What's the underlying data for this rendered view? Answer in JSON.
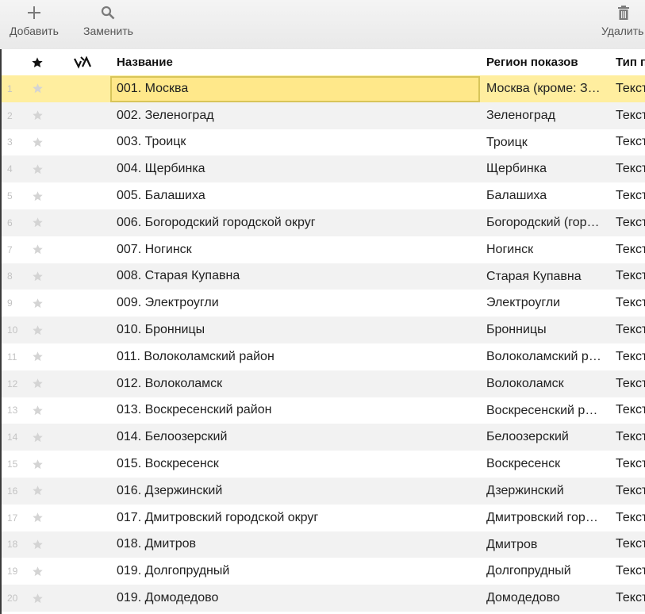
{
  "toolbar": {
    "add_label": "Добавить",
    "replace_label": "Заменить",
    "delete_label": "Удалить"
  },
  "header": {
    "name_label": "Название",
    "region_label": "Регион показов",
    "type_label": "Тип п"
  },
  "colors": {
    "selected_row": "#ffee9f",
    "selected_cell_border": "#d8c55a",
    "alt_row": "#f2f2f2",
    "star_inactive": "#d4d4d4"
  },
  "icons": {
    "add": "plus-icon",
    "replace": "search-icon",
    "delete": "trash-icon",
    "favorite_header": "star-icon",
    "mark_header": "mark-icon"
  },
  "rows": [
    {
      "num": "1",
      "name": "001. Москва",
      "region": "Москва (кроме: Зеленоград)",
      "type": "Текст"
    },
    {
      "num": "2",
      "name": "002. Зеленоград",
      "region": "Зеленоград",
      "type": "Текст"
    },
    {
      "num": "3",
      "name": "003. Троицк",
      "region": "Троицк",
      "type": "Текст"
    },
    {
      "num": "4",
      "name": "004. Щербинка",
      "region": "Щербинка",
      "type": "Текст"
    },
    {
      "num": "5",
      "name": "005. Балашиха",
      "region": "Балашиха",
      "type": "Текст"
    },
    {
      "num": "6",
      "name": "006. Богородский городской округ",
      "region": "Богородский (городской округ)",
      "type": "Текст"
    },
    {
      "num": "7",
      "name": "007. Ногинск",
      "region": "Ногинск",
      "type": "Текст"
    },
    {
      "num": "8",
      "name": "008. Старая Купавна",
      "region": "Старая Купавна",
      "type": "Текст"
    },
    {
      "num": "9",
      "name": "009. Электроугли",
      "region": "Электроугли",
      "type": "Текст"
    },
    {
      "num": "10",
      "name": "010. Бронницы",
      "region": "Бронницы",
      "type": "Текст"
    },
    {
      "num": "11",
      "name": "011. Волоколамский район",
      "region": "Волоколамский район",
      "type": "Текст"
    },
    {
      "num": "12",
      "name": "012. Волоколамск",
      "region": "Волоколамск",
      "type": "Текст"
    },
    {
      "num": "13",
      "name": "013. Воскресенский район",
      "region": "Воскресенский район",
      "type": "Текст"
    },
    {
      "num": "14",
      "name": "014. Белоозерский",
      "region": "Белоозерский",
      "type": "Текст"
    },
    {
      "num": "15",
      "name": "015. Воскресенск",
      "region": "Воскресенск",
      "type": "Текст"
    },
    {
      "num": "16",
      "name": "016. Дзержинский",
      "region": "Дзержинский",
      "type": "Текст"
    },
    {
      "num": "17",
      "name": "017. Дмитровский городской округ",
      "region": "Дмитровский городской округ",
      "type": "Текст"
    },
    {
      "num": "18",
      "name": "018. Дмитров",
      "region": "Дмитров",
      "type": "Текст"
    },
    {
      "num": "19",
      "name": "019. Долгопрудный",
      "region": "Долгопрудный",
      "type": "Текст"
    },
    {
      "num": "20",
      "name": "019. Домодедово",
      "region": "Домодедово",
      "type": "Текст"
    }
  ]
}
